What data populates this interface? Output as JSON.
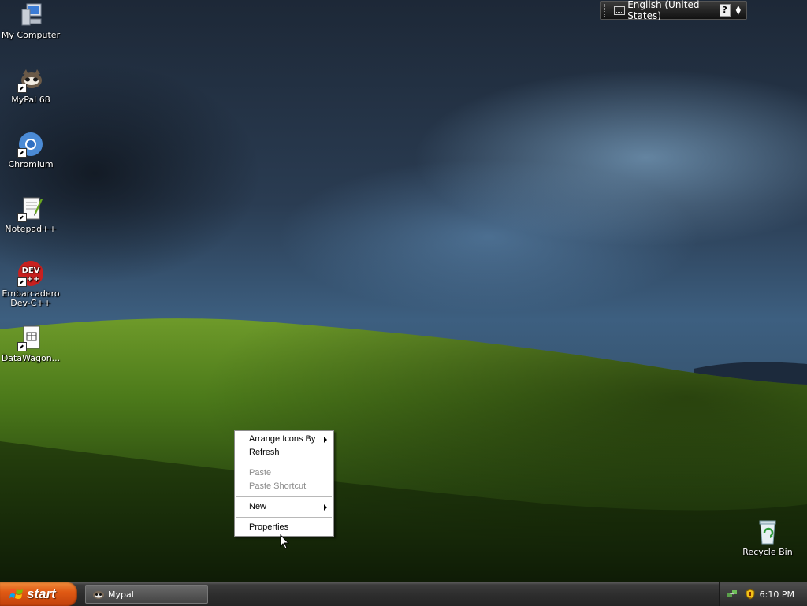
{
  "desktop": {
    "icons": [
      {
        "label": "My Computer",
        "icon": "my-computer-icon"
      },
      {
        "label": "MyPal 68",
        "icon": "mypal-icon"
      },
      {
        "label": "Chromium",
        "icon": "chromium-icon"
      },
      {
        "label": "Notepad++",
        "icon": "notepad-plus-plus-icon"
      },
      {
        "label": "Embarcadero Dev-C++",
        "line1": "Embarcadero",
        "line2": "Dev-C++",
        "icon": "dev-cpp-icon"
      },
      {
        "label": "DataWagon...",
        "icon": "datawagon-icon"
      }
    ],
    "recycle_bin": {
      "label": "Recycle Bin",
      "icon": "recycle-bin-icon"
    }
  },
  "language_bar": {
    "language": "English (United States)",
    "help": "?"
  },
  "context_menu": {
    "items": [
      {
        "label": "Arrange Icons By",
        "submenu": true,
        "enabled": true
      },
      {
        "label": "Refresh",
        "submenu": false,
        "enabled": true
      },
      {
        "label": "Paste",
        "submenu": false,
        "enabled": false
      },
      {
        "label": "Paste Shortcut",
        "submenu": false,
        "enabled": false
      },
      {
        "label": "New",
        "submenu": true,
        "enabled": true
      },
      {
        "label": "Properties",
        "submenu": false,
        "enabled": true
      }
    ]
  },
  "taskbar": {
    "start_label": "start",
    "tasks": [
      {
        "label": "Mypal",
        "icon": "mypal-icon"
      }
    ],
    "tray": {
      "clock": "6:10 PM"
    }
  },
  "colors": {
    "start_button": "#e05a14",
    "taskbar": "#2e2e2e",
    "sky": "#3d5f80",
    "grass": "#4c7a1a"
  }
}
